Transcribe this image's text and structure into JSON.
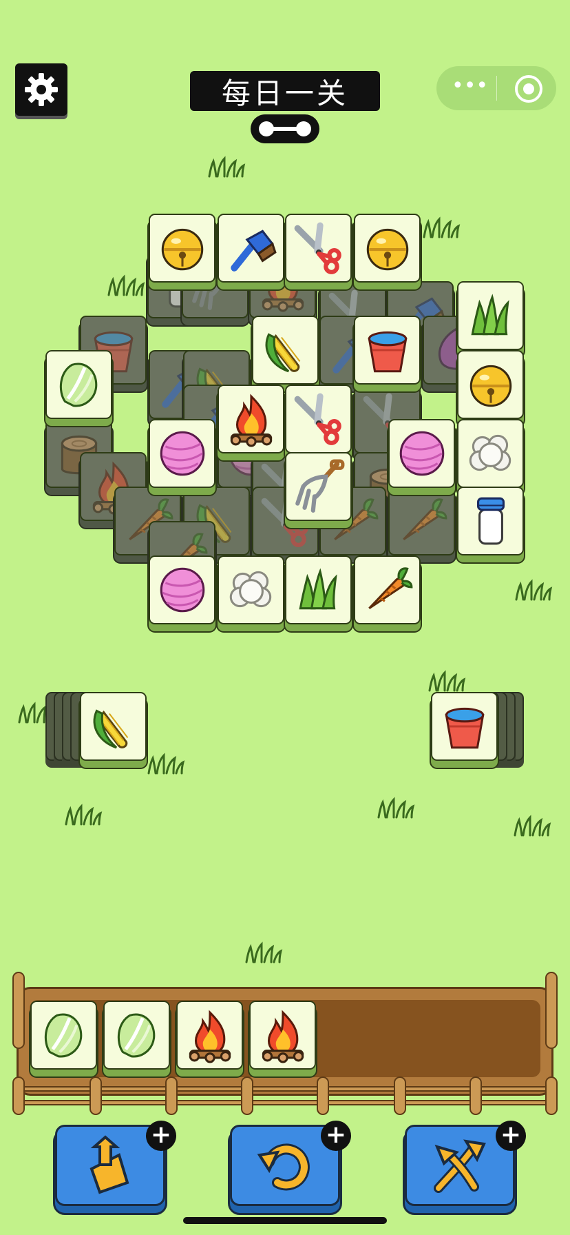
{
  "header": {
    "title": "每日一关",
    "settings_icon": "gear-icon",
    "progress_icon": "progress-pill-icon",
    "capsule_more": "•••",
    "capsule_target_icon": "target-icon"
  },
  "colors": {
    "background": "#c2f28a",
    "tile_face": "#f6fcdc",
    "tile_base": "#7eab4b",
    "button_blue": "#3d8be3",
    "tray_wood": "#b27b3d"
  },
  "board": {
    "visible_tiles": [
      "bell",
      "brush",
      "shears",
      "bell",
      "grass",
      "bucket",
      "cabbage",
      "corn",
      "bell",
      "fire",
      "shears",
      "yarn",
      "yarn",
      "wool",
      "fork",
      "milk",
      "yarn",
      "wool",
      "grass",
      "carrot"
    ],
    "covered_tiles": [
      "milk",
      "fork",
      "fire",
      "bucket",
      "shears",
      "brush",
      "grass",
      "stump",
      "brush",
      "corn",
      "onion",
      "fire",
      "stump",
      "shears",
      "brush",
      "shears",
      "carrot",
      "corn",
      "carrot",
      "stump",
      "carrot",
      "carrot",
      "shears",
      "corn"
    ]
  },
  "side_stacks": {
    "left": {
      "top_tile": "corn"
    },
    "right": {
      "top_tile": "bucket"
    }
  },
  "tray": {
    "slots": [
      "cabbage",
      "cabbage",
      "fire",
      "fire"
    ],
    "capacity": 7
  },
  "tools": [
    {
      "name": "move-out",
      "icon": "move-out-icon"
    },
    {
      "name": "undo",
      "icon": "undo-icon"
    },
    {
      "name": "shuffle",
      "icon": "shuffle-icon"
    }
  ]
}
